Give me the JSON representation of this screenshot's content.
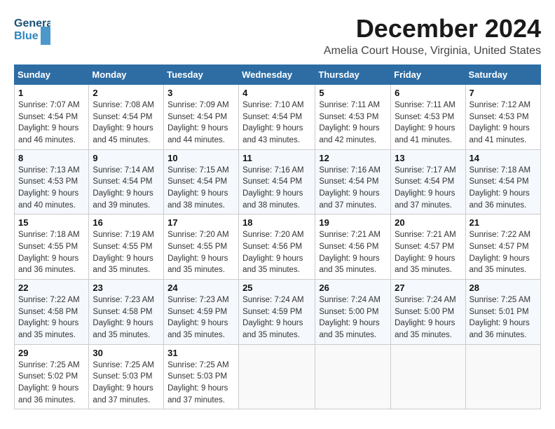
{
  "header": {
    "logo_line1": "General",
    "logo_line2": "Blue",
    "month": "December 2024",
    "location": "Amelia Court House, Virginia, United States"
  },
  "weekdays": [
    "Sunday",
    "Monday",
    "Tuesday",
    "Wednesday",
    "Thursday",
    "Friday",
    "Saturday"
  ],
  "weeks": [
    [
      {
        "day": 1,
        "sunrise": "7:07 AM",
        "sunset": "4:54 PM",
        "daylight": "9 hours and 46 minutes."
      },
      {
        "day": 2,
        "sunrise": "7:08 AM",
        "sunset": "4:54 PM",
        "daylight": "9 hours and 45 minutes."
      },
      {
        "day": 3,
        "sunrise": "7:09 AM",
        "sunset": "4:54 PM",
        "daylight": "9 hours and 44 minutes."
      },
      {
        "day": 4,
        "sunrise": "7:10 AM",
        "sunset": "4:54 PM",
        "daylight": "9 hours and 43 minutes."
      },
      {
        "day": 5,
        "sunrise": "7:11 AM",
        "sunset": "4:53 PM",
        "daylight": "9 hours and 42 minutes."
      },
      {
        "day": 6,
        "sunrise": "7:11 AM",
        "sunset": "4:53 PM",
        "daylight": "9 hours and 41 minutes."
      },
      {
        "day": 7,
        "sunrise": "7:12 AM",
        "sunset": "4:53 PM",
        "daylight": "9 hours and 41 minutes."
      }
    ],
    [
      {
        "day": 8,
        "sunrise": "7:13 AM",
        "sunset": "4:53 PM",
        "daylight": "9 hours and 40 minutes."
      },
      {
        "day": 9,
        "sunrise": "7:14 AM",
        "sunset": "4:54 PM",
        "daylight": "9 hours and 39 minutes."
      },
      {
        "day": 10,
        "sunrise": "7:15 AM",
        "sunset": "4:54 PM",
        "daylight": "9 hours and 38 minutes."
      },
      {
        "day": 11,
        "sunrise": "7:16 AM",
        "sunset": "4:54 PM",
        "daylight": "9 hours and 38 minutes."
      },
      {
        "day": 12,
        "sunrise": "7:16 AM",
        "sunset": "4:54 PM",
        "daylight": "9 hours and 37 minutes."
      },
      {
        "day": 13,
        "sunrise": "7:17 AM",
        "sunset": "4:54 PM",
        "daylight": "9 hours and 37 minutes."
      },
      {
        "day": 14,
        "sunrise": "7:18 AM",
        "sunset": "4:54 PM",
        "daylight": "9 hours and 36 minutes."
      }
    ],
    [
      {
        "day": 15,
        "sunrise": "7:18 AM",
        "sunset": "4:55 PM",
        "daylight": "9 hours and 36 minutes."
      },
      {
        "day": 16,
        "sunrise": "7:19 AM",
        "sunset": "4:55 PM",
        "daylight": "9 hours and 35 minutes."
      },
      {
        "day": 17,
        "sunrise": "7:20 AM",
        "sunset": "4:55 PM",
        "daylight": "9 hours and 35 minutes."
      },
      {
        "day": 18,
        "sunrise": "7:20 AM",
        "sunset": "4:56 PM",
        "daylight": "9 hours and 35 minutes."
      },
      {
        "day": 19,
        "sunrise": "7:21 AM",
        "sunset": "4:56 PM",
        "daylight": "9 hours and 35 minutes."
      },
      {
        "day": 20,
        "sunrise": "7:21 AM",
        "sunset": "4:57 PM",
        "daylight": "9 hours and 35 minutes."
      },
      {
        "day": 21,
        "sunrise": "7:22 AM",
        "sunset": "4:57 PM",
        "daylight": "9 hours and 35 minutes."
      }
    ],
    [
      {
        "day": 22,
        "sunrise": "7:22 AM",
        "sunset": "4:58 PM",
        "daylight": "9 hours and 35 minutes."
      },
      {
        "day": 23,
        "sunrise": "7:23 AM",
        "sunset": "4:58 PM",
        "daylight": "9 hours and 35 minutes."
      },
      {
        "day": 24,
        "sunrise": "7:23 AM",
        "sunset": "4:59 PM",
        "daylight": "9 hours and 35 minutes."
      },
      {
        "day": 25,
        "sunrise": "7:24 AM",
        "sunset": "4:59 PM",
        "daylight": "9 hours and 35 minutes."
      },
      {
        "day": 26,
        "sunrise": "7:24 AM",
        "sunset": "5:00 PM",
        "daylight": "9 hours and 35 minutes."
      },
      {
        "day": 27,
        "sunrise": "7:24 AM",
        "sunset": "5:00 PM",
        "daylight": "9 hours and 35 minutes."
      },
      {
        "day": 28,
        "sunrise": "7:25 AM",
        "sunset": "5:01 PM",
        "daylight": "9 hours and 36 minutes."
      }
    ],
    [
      {
        "day": 29,
        "sunrise": "7:25 AM",
        "sunset": "5:02 PM",
        "daylight": "9 hours and 36 minutes."
      },
      {
        "day": 30,
        "sunrise": "7:25 AM",
        "sunset": "5:03 PM",
        "daylight": "9 hours and 37 minutes."
      },
      {
        "day": 31,
        "sunrise": "7:25 AM",
        "sunset": "5:03 PM",
        "daylight": "9 hours and 37 minutes."
      },
      null,
      null,
      null,
      null
    ]
  ]
}
